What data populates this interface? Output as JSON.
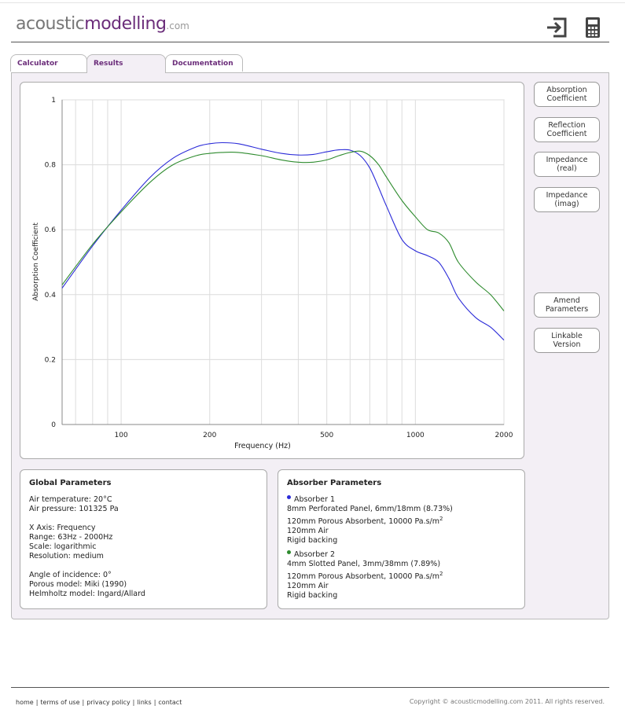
{
  "logo": {
    "part1": "acoustic",
    "part2": "modelling",
    "part3": ".com"
  },
  "header": {
    "icons": [
      "login-arrow-icon",
      "calculator-icon"
    ]
  },
  "tabs": [
    {
      "label": "Calculator"
    },
    {
      "label": "Results"
    },
    {
      "label": "Documentation"
    }
  ],
  "side_buttons": [
    {
      "line1": "Absorption",
      "line2": "Coefficient"
    },
    {
      "line1": "Reflection",
      "line2": "Coefficient"
    },
    {
      "line1": "Impedance",
      "line2": "(real)"
    },
    {
      "line1": "Impedance",
      "line2": "(imag)"
    },
    {
      "line1": "Amend",
      "line2": "Parameters"
    },
    {
      "line1": "Linkable",
      "line2": "Version"
    }
  ],
  "chart_data": {
    "type": "line",
    "xlabel": "Frequency (Hz)",
    "ylabel": "Absorption Coefficient",
    "x_scale": "log",
    "xlim": [
      63,
      2000
    ],
    "ylim": [
      0,
      1
    ],
    "x_ticks": [
      100,
      200,
      500,
      1000,
      2000
    ],
    "x_tick_labels": [
      "100",
      "200",
      "500",
      "1000",
      "2000"
    ],
    "y_ticks": [
      0,
      0.2,
      0.4,
      0.6,
      0.8,
      1
    ],
    "y_tick_labels": [
      "0",
      "0.2",
      "0.4",
      "0.6",
      "0.8",
      "1"
    ],
    "grid": true,
    "series": [
      {
        "color": "#2b2bd8",
        "x": [
          63,
          80,
          100,
          125,
          150,
          180,
          200,
          220,
          250,
          300,
          350,
          400,
          450,
          500,
          550,
          600,
          650,
          700,
          750,
          800,
          900,
          1000,
          1100,
          1200,
          1300,
          1400,
          1600,
          1800,
          2000
        ],
        "y": [
          0.42,
          0.55,
          0.66,
          0.76,
          0.82,
          0.855,
          0.865,
          0.868,
          0.865,
          0.848,
          0.835,
          0.83,
          0.832,
          0.84,
          0.846,
          0.845,
          0.828,
          0.79,
          0.73,
          0.67,
          0.57,
          0.535,
          0.52,
          0.5,
          0.45,
          0.39,
          0.33,
          0.3,
          0.26
        ]
      },
      {
        "color": "#2e8b2e",
        "x": [
          63,
          80,
          100,
          125,
          150,
          180,
          200,
          220,
          250,
          300,
          350,
          400,
          450,
          500,
          550,
          600,
          650,
          700,
          750,
          800,
          900,
          1000,
          1100,
          1200,
          1300,
          1400,
          1600,
          1800,
          2000
        ],
        "y": [
          0.43,
          0.555,
          0.655,
          0.745,
          0.8,
          0.828,
          0.835,
          0.838,
          0.838,
          0.828,
          0.815,
          0.808,
          0.808,
          0.815,
          0.828,
          0.838,
          0.842,
          0.828,
          0.8,
          0.76,
          0.69,
          0.64,
          0.6,
          0.59,
          0.56,
          0.5,
          0.44,
          0.4,
          0.35
        ]
      }
    ]
  },
  "global_params": {
    "title": "Global Parameters",
    "air_temperature": "Air temperature: 20°C",
    "air_pressure": "Air pressure: 101325 Pa",
    "x_axis": "X Axis: Frequency",
    "range": "Range: 63Hz - 2000Hz",
    "scale": "Scale: logarithmic",
    "resolution": "Resolution: medium",
    "angle": "Angle of incidence: 0°",
    "porous_model": "Porous model: Miki (1990)",
    "helmholtz_model": "Helmholtz model: Ingard/Allard"
  },
  "absorber_params": {
    "title": "Absorber Parameters",
    "absorbers": [
      {
        "name": "Absorber 1",
        "color": "#2b2bd8",
        "layer1": "8mm Perforated Panel, 6mm/18mm (8.73%)",
        "layer2": "120mm Porous Absorbent, 10000 Pa.s/m",
        "layer2_sup": "2",
        "layer3": "120mm Air",
        "layer4": "Rigid backing"
      },
      {
        "name": "Absorber 2",
        "color": "#2e8b2e",
        "layer1": "4mm Slotted Panel, 3mm/38mm (7.89%)",
        "layer2": "120mm Porous Absorbent, 10000 Pa.s/m",
        "layer2_sup": "2",
        "layer3": "120mm Air",
        "layer4": "Rigid backing"
      }
    ]
  },
  "footer": {
    "links": [
      "home",
      "terms of use",
      "privacy policy",
      "links",
      "contact"
    ],
    "separator": "|",
    "copyright": "Copyright © acousticmodelling.com 2011. All rights reserved."
  }
}
